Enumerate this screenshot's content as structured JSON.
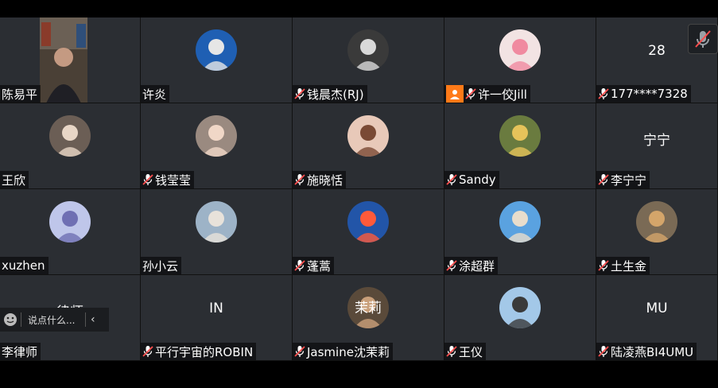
{
  "participants": [
    {
      "name": "陈易平",
      "type": "video",
      "muted": false
    },
    {
      "name": "许炎",
      "type": "avatar",
      "muted": false,
      "avatar_colors": [
        "#1f5fb3",
        "#e6e6e6"
      ]
    },
    {
      "name": "钱晨杰(RJ)",
      "type": "avatar",
      "muted": true,
      "avatar_colors": [
        "#3a3a3a",
        "#d9d9d9"
      ]
    },
    {
      "name": "许一佼Jill",
      "type": "avatar",
      "muted": true,
      "host": true,
      "avatar_colors": [
        "#f2e3e3",
        "#f08aa0"
      ]
    },
    {
      "name": "177****7328",
      "type": "text",
      "label": "28",
      "muted": true
    },
    {
      "name": "王欣",
      "type": "avatar",
      "muted": false,
      "avatar_colors": [
        "#6b5e55",
        "#e8d6c6"
      ]
    },
    {
      "name": "钱莹莹",
      "type": "avatar",
      "muted": true,
      "avatar_colors": [
        "#9a8a80",
        "#f0d7c7"
      ]
    },
    {
      "name": "施晓恬",
      "type": "avatar",
      "muted": true,
      "avatar_colors": [
        "#e8c9b9",
        "#7a4a35"
      ]
    },
    {
      "name": "Sandy",
      "type": "avatar",
      "muted": true,
      "avatar_colors": [
        "#6a7b3f",
        "#e6c35a"
      ]
    },
    {
      "name": "李宁宁",
      "type": "text",
      "label": "宁宁",
      "muted": true
    },
    {
      "name": "xuzhen",
      "type": "avatar",
      "muted": false,
      "avatar_colors": [
        "#bfc6ea",
        "#6f6fb3"
      ]
    },
    {
      "name": "孙小云",
      "type": "avatar",
      "muted": false,
      "avatar_colors": [
        "#9db3c7",
        "#e8e2da"
      ]
    },
    {
      "name": "蓬蒿",
      "type": "avatar",
      "muted": true,
      "avatar_colors": [
        "#2255a8",
        "#ff5a3a"
      ]
    },
    {
      "name": "涂超群",
      "type": "avatar",
      "muted": true,
      "avatar_colors": [
        "#5aa2e0",
        "#e8ddcc"
      ]
    },
    {
      "name": "土生金",
      "type": "avatar",
      "muted": true,
      "avatar_colors": [
        "#7a6a55",
        "#d4a56a"
      ]
    },
    {
      "name": "李律师",
      "type": "text",
      "label": "律师",
      "muted": false
    },
    {
      "name": "平行宇宙的ROBIN",
      "type": "text",
      "label": "IN",
      "muted": true
    },
    {
      "name": "Jasmine沈茉莉",
      "type": "avatar",
      "muted": true,
      "avatar_label": "茉莉",
      "avatar_colors": [
        "#5a4a3a",
        "#c99f7a"
      ]
    },
    {
      "name": "王仪",
      "type": "avatar",
      "muted": true,
      "avatar_colors": [
        "#a3c8e8",
        "#3a3a3a"
      ]
    },
    {
      "name": "陆凌燕BI4UMU",
      "type": "text",
      "label": "MU",
      "muted": true
    }
  ],
  "chat_placeholder": "说点什么...",
  "colors": {
    "tile": "#2b2e33",
    "host_badge": "#ff7a18",
    "mute_icon": "#ff4d4d"
  }
}
